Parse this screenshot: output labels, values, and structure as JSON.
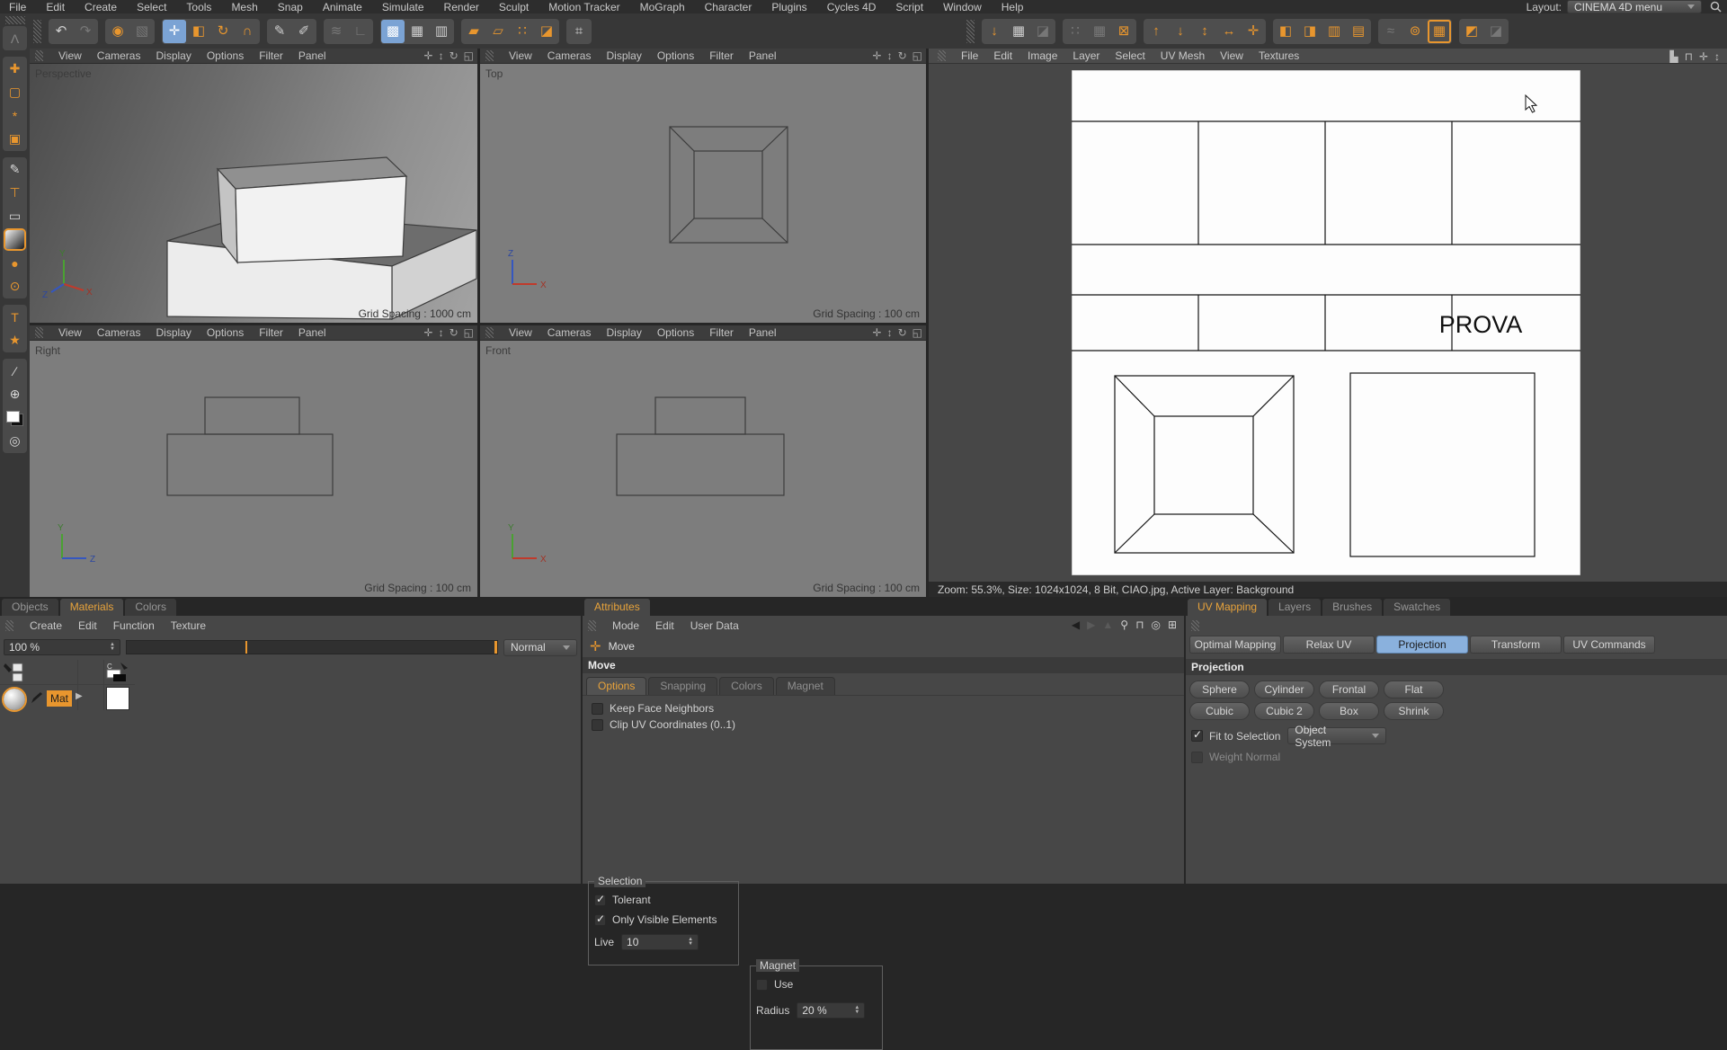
{
  "menubar": {
    "items": [
      "File",
      "Edit",
      "Create",
      "Select",
      "Tools",
      "Mesh",
      "Snap",
      "Animate",
      "Simulate",
      "Render",
      "Sculpt",
      "Motion Tracker",
      "MoGraph",
      "Character",
      "Plugins",
      "Cycles 4D",
      "Script",
      "Window",
      "Help"
    ],
    "layout_label": "Layout:",
    "layout_value": "CINEMA 4D menu"
  },
  "main_toolbar": {
    "g1": [
      {
        "name": "undo-icon",
        "glyph": "↶"
      },
      {
        "name": "redo-icon",
        "glyph": "↷",
        "disabled": true
      }
    ],
    "g2": [
      {
        "name": "live-selection-icon",
        "glyph": "◉",
        "cls": "orange"
      },
      {
        "name": "viewport-solo-icon",
        "glyph": "▧",
        "disabled": true
      }
    ],
    "g3": [
      {
        "name": "move-tool-icon",
        "glyph": "✛",
        "active": true
      },
      {
        "name": "scale-tool-icon",
        "glyph": "◧",
        "cls": "orange"
      },
      {
        "name": "rotate-tool-icon",
        "glyph": "↻",
        "cls": "orange"
      },
      {
        "name": "magnet-tool-icon",
        "glyph": "∩",
        "cls": "orange"
      }
    ],
    "g4": [
      {
        "name": "paint-brush-icon",
        "glyph": "✎"
      },
      {
        "name": "paint-3d-icon",
        "glyph": "✐"
      }
    ],
    "g5": [
      {
        "name": "sculpt-icon",
        "glyph": "≋",
        "disabled": true
      },
      {
        "name": "axis-mod-icon",
        "glyph": "∟",
        "disabled": true
      }
    ],
    "g6": [
      {
        "name": "uv-polygon-mode-icon",
        "glyph": "▩",
        "active": true
      },
      {
        "name": "uv-point-mode-icon",
        "glyph": "▦"
      },
      {
        "name": "uv-edge-mode-icon",
        "glyph": "▥"
      }
    ],
    "g7": [
      {
        "name": "polygon-mode-icon",
        "glyph": "▰",
        "cls": "orange"
      },
      {
        "name": "edge-mode-icon",
        "glyph": "▱",
        "cls": "orange"
      },
      {
        "name": "point-mode-icon",
        "glyph": "∷",
        "cls": "orange"
      },
      {
        "name": "model-mode-icon",
        "glyph": "◪",
        "cls": "orange"
      }
    ],
    "g8": [
      {
        "name": "texture-mode-icon",
        "glyph": "⌗"
      }
    ],
    "uv1": [
      {
        "name": "uv-apply-icon",
        "glyph": "↓",
        "cls": "orange"
      },
      {
        "name": "uv-region-icon",
        "glyph": "▦"
      },
      {
        "name": "uv-release-icon",
        "glyph": "◪",
        "disabled": true
      }
    ],
    "uv2": [
      {
        "name": "uv-dots-icon",
        "glyph": "∷",
        "disabled": true
      },
      {
        "name": "uv-grid-icon",
        "glyph": "▦",
        "disabled": true
      },
      {
        "name": "uv-clear-icon",
        "glyph": "⊠",
        "cls": "orange"
      }
    ],
    "uv3": [
      {
        "name": "uv-align-up-icon",
        "glyph": "↑",
        "cls": "orange"
      },
      {
        "name": "uv-align-down-icon",
        "glyph": "↓",
        "cls": "orange"
      },
      {
        "name": "uv-fit-height-icon",
        "glyph": "↕",
        "cls": "orange"
      },
      {
        "name": "uv-expand-icon",
        "glyph": "↔",
        "cls": "orange"
      },
      {
        "name": "uv-center-icon",
        "glyph": "✛",
        "cls": "orange"
      }
    ],
    "uv4": [
      {
        "name": "uv-mirror-h-icon",
        "glyph": "◧",
        "cls": "orange"
      },
      {
        "name": "uv-mirror-v-icon",
        "glyph": "◨",
        "cls": "orange"
      },
      {
        "name": "uv-columns-icon",
        "glyph": "▥",
        "cls": "orange"
      },
      {
        "name": "uv-rows-icon",
        "glyph": "▤",
        "cls": "orange"
      }
    ],
    "uv5": [
      {
        "name": "uv-relax-icon",
        "glyph": "≈",
        "disabled": true
      },
      {
        "name": "uv-relax-circle-icon",
        "glyph": "⊚",
        "cls": "orange"
      },
      {
        "name": "uv-relax-grid-icon",
        "glyph": "▦",
        "cls": "activeorange"
      }
    ],
    "uv6": [
      {
        "name": "uv-pin-icon",
        "glyph": "◩",
        "cls": "orange"
      },
      {
        "name": "uv-pin2-icon",
        "glyph": "◪",
        "disabled": true
      }
    ]
  },
  "left_toolbar": {
    "l1": [
      {
        "name": "bodypaint-logo",
        "glyph": "Λ",
        "disabled": true
      }
    ],
    "l2": [
      {
        "name": "move-layer-icon",
        "glyph": "✚",
        "cls": "orange"
      },
      {
        "name": "marquee-select-icon",
        "glyph": "▢",
        "cls": "orange"
      },
      {
        "name": "magic-wand-icon",
        "glyph": "*",
        "cls": "orange"
      },
      {
        "name": "crop-frame-icon",
        "glyph": "▣",
        "cls": "orange"
      }
    ],
    "l3": [
      {
        "name": "brush-icon",
        "glyph": "✎"
      },
      {
        "name": "stamp-icon",
        "glyph": "⊤",
        "cls": "orange"
      },
      {
        "name": "eraser-icon",
        "glyph": "▭"
      },
      {
        "name": "gradient-icon",
        "glyph": "",
        "cls": "grad"
      },
      {
        "name": "blur-drop-icon",
        "glyph": "●",
        "cls": "orange"
      },
      {
        "name": "smudge-icon",
        "glyph": "⊙",
        "cls": "orange"
      }
    ],
    "l4": [
      {
        "name": "text-tool-icon",
        "glyph": "T",
        "cls": "orange"
      },
      {
        "name": "star-shape-icon",
        "glyph": "★",
        "cls": "orange"
      }
    ],
    "l5": [
      {
        "name": "eyedropper-icon",
        "glyph": "∕"
      },
      {
        "name": "zoom-tool-icon",
        "glyph": "⊕"
      },
      {
        "name": "color-swatches-icon",
        "glyph": "",
        "cls": "swatch"
      },
      {
        "name": "projection-paint-icon",
        "glyph": "◎"
      }
    ]
  },
  "viewports": {
    "menu_items": [
      "View",
      "Cameras",
      "Display",
      "Options",
      "Filter",
      "Panel"
    ],
    "corner_icons": [
      {
        "name": "pan-icon",
        "glyph": "✛"
      },
      {
        "name": "dolly-icon",
        "glyph": "↕"
      },
      {
        "name": "orbit-icon",
        "glyph": "↻"
      },
      {
        "name": "toggle-view-icon",
        "glyph": "◱"
      }
    ],
    "panels": [
      {
        "label": "Perspective",
        "grid_spacing": "Grid Spacing : 1000 cm"
      },
      {
        "label": "Top",
        "grid_spacing": "Grid Spacing : 100 cm"
      },
      {
        "label": "Right",
        "grid_spacing": "Grid Spacing : 100 cm"
      },
      {
        "label": "Front",
        "grid_spacing": "Grid Spacing : 100 cm"
      }
    ],
    "axis_labels": {
      "x": "X",
      "y": "Y",
      "z": "Z"
    }
  },
  "texture_view": {
    "menu_items": [
      "File",
      "Edit",
      "Image",
      "Layer",
      "Select",
      "UV Mesh",
      "View",
      "Textures"
    ],
    "corner_icons": [
      {
        "name": "histogram-icon",
        "glyph": "▙"
      },
      {
        "name": "lock-icon",
        "glyph": "⊓"
      },
      {
        "name": "pan-icon",
        "glyph": "✛"
      },
      {
        "name": "scale-icon",
        "glyph": "↕"
      }
    ],
    "canvas_text": "PROVA",
    "status": "Zoom: 55.3%, Size: 1024x1024, 8 Bit, CIAO.jpg, Active Layer: Background"
  },
  "materials_panel": {
    "tabs": [
      {
        "label": "Objects"
      },
      {
        "label": "Materials",
        "active": true
      },
      {
        "label": "Colors"
      }
    ],
    "menu_items": [
      "Create",
      "Edit",
      "Function",
      "Texture"
    ],
    "opacity_value": "100 %",
    "blend_mode": "Normal",
    "material_name": "Mat"
  },
  "attributes_panel": {
    "tabs": [
      {
        "label": "Attributes",
        "active": true
      }
    ],
    "menu_items": [
      "Mode",
      "Edit",
      "User Data"
    ],
    "tool_label": "Move",
    "section_title": "Move",
    "tool_tabs": [
      {
        "label": "Options",
        "active": true
      },
      {
        "label": "Snapping"
      },
      {
        "label": "Colors"
      },
      {
        "label": "Magnet"
      }
    ],
    "checkboxes": [
      {
        "label": "Keep Face Neighbors",
        "checked": false
      },
      {
        "label": "Clip UV Coordinates (0..1)",
        "checked": false
      }
    ],
    "selection_group": {
      "title": "Selection",
      "items": [
        {
          "label": "Tolerant",
          "checked": true
        },
        {
          "label": "Only Visible Elements",
          "checked": true
        }
      ],
      "live_label": "Live",
      "live_value": "10"
    },
    "magnet_group": {
      "title": "Magnet",
      "use": {
        "label": "Use",
        "checked": false
      },
      "radius_label": "Radius",
      "radius_value": "20 %"
    }
  },
  "uv_panel": {
    "tabs": [
      {
        "label": "UV Mapping",
        "active": true
      },
      {
        "label": "Layers"
      },
      {
        "label": "Brushes"
      },
      {
        "label": "Swatches"
      }
    ],
    "mode_buttons": [
      {
        "label": "Optimal Mapping"
      },
      {
        "label": "Relax UV"
      },
      {
        "label": "Projection",
        "active": true
      },
      {
        "label": "Transform"
      },
      {
        "label": "UV Commands"
      }
    ],
    "section_title": "Projection",
    "projection_row1": [
      {
        "label": "Sphere"
      },
      {
        "label": "Cylinder"
      },
      {
        "label": "Frontal"
      },
      {
        "label": "Flat"
      }
    ],
    "projection_row2": [
      {
        "label": "Cubic"
      },
      {
        "label": "Cubic 2"
      },
      {
        "label": "Box"
      },
      {
        "label": "Shrink"
      }
    ],
    "fit_to_selection": {
      "label": "Fit to Selection",
      "checked": true
    },
    "coord_system": "Object System",
    "weight_normal": {
      "label": "Weight Normal",
      "checked": false
    }
  },
  "colors": {
    "accent_orange": "#e8962e",
    "active_blue": "#7ba3d4",
    "panel_bg": "#474747",
    "canvas_bg": "#fdfdfd"
  }
}
